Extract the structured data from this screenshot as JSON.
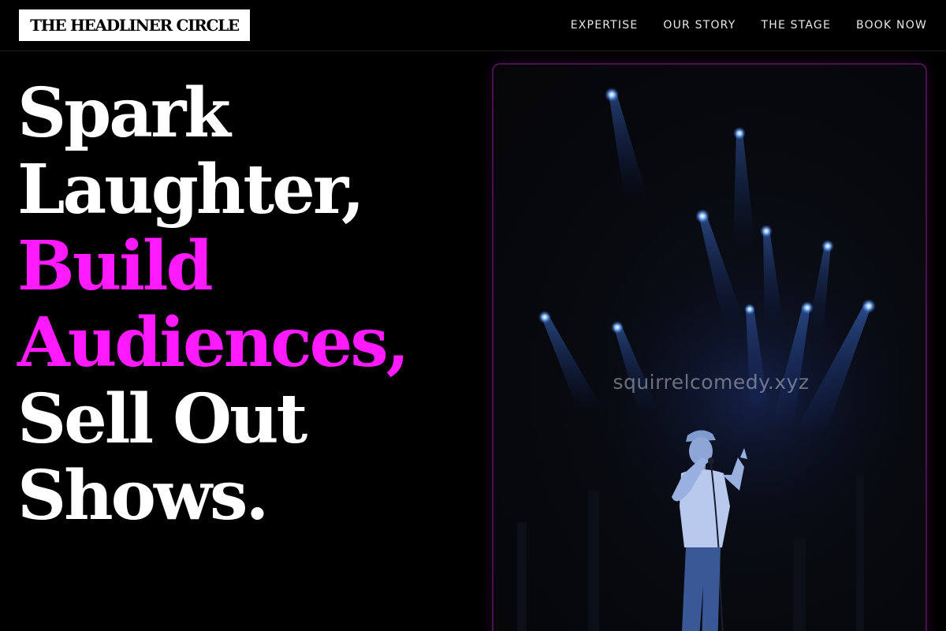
{
  "brand": {
    "logo_text": "THE HEADLINER CIRCLE"
  },
  "nav": {
    "items": [
      {
        "label": "EXPERTISE"
      },
      {
        "label": "OUR STORY"
      },
      {
        "label": "THE STAGE"
      },
      {
        "label": "BOOK NOW"
      }
    ]
  },
  "hero": {
    "lines": [
      {
        "text": "Spark"
      },
      {
        "text": "Laughter,"
      },
      {
        "text": "Build"
      },
      {
        "text": "Audiences,"
      },
      {
        "text": "Sell Out"
      },
      {
        "text": "Shows."
      }
    ]
  },
  "stage_image": {
    "watermark": "squirrelcomedy.xyz",
    "icon": "comedian-on-stage-photo"
  },
  "colors": {
    "background": "#000000",
    "accent": "#ff1aff",
    "text": "#ffffff",
    "card_border": "#4a1050",
    "spotlight": "#3a78ff"
  }
}
